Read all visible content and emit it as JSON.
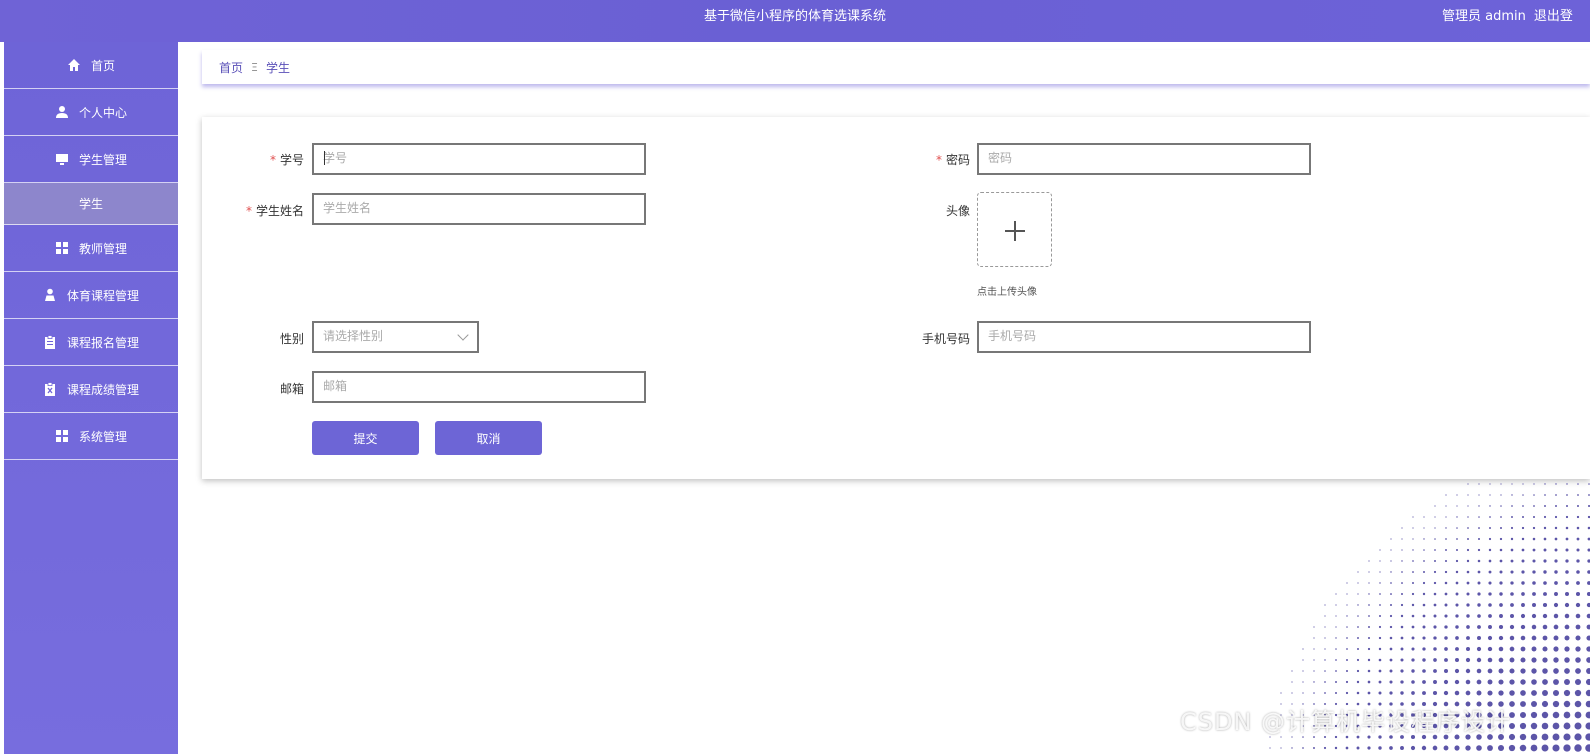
{
  "header": {
    "title": "基于微信小程序的体育选课系统",
    "user_label": "管理员 admin",
    "logout_label": "退出登"
  },
  "sidebar": {
    "items": [
      {
        "label": "首页",
        "icon": "home-icon"
      },
      {
        "label": "个人中心",
        "icon": "user-icon"
      },
      {
        "label": "学生管理",
        "icon": "monitor-icon"
      },
      {
        "label": "学生",
        "icon": ""
      },
      {
        "label": "教师管理",
        "icon": "grid-icon"
      },
      {
        "label": "体育课程管理",
        "icon": "person-icon"
      },
      {
        "label": "课程报名管理",
        "icon": "clipboard-icon"
      },
      {
        "label": "课程成绩管理",
        "icon": "clipboard-x-icon"
      },
      {
        "label": "系统管理",
        "icon": "grid-icon"
      }
    ]
  },
  "breadcrumb": {
    "home": "首页",
    "separator": "Ξ",
    "current": "学生"
  },
  "form": {
    "student_id": {
      "label": "学号",
      "placeholder": "学号",
      "required": true
    },
    "password": {
      "label": "密码",
      "placeholder": "密码",
      "required": true
    },
    "student_name": {
      "label": "学生姓名",
      "placeholder": "学生姓名",
      "required": true
    },
    "avatar": {
      "label": "头像",
      "hint": "点击上传头像"
    },
    "gender": {
      "label": "性别",
      "placeholder": "请选择性别"
    },
    "phone": {
      "label": "手机号码",
      "placeholder": "手机号码"
    },
    "email": {
      "label": "邮箱",
      "placeholder": "邮箱"
    },
    "submit_label": "提交",
    "cancel_label": "取消",
    "required_mark": "*"
  },
  "watermark": "CSDN @计算机毕设程序设计",
  "colors": {
    "brand": "#6d65d6",
    "sidebar_active": "#8d86cc",
    "required": "#e05050"
  }
}
